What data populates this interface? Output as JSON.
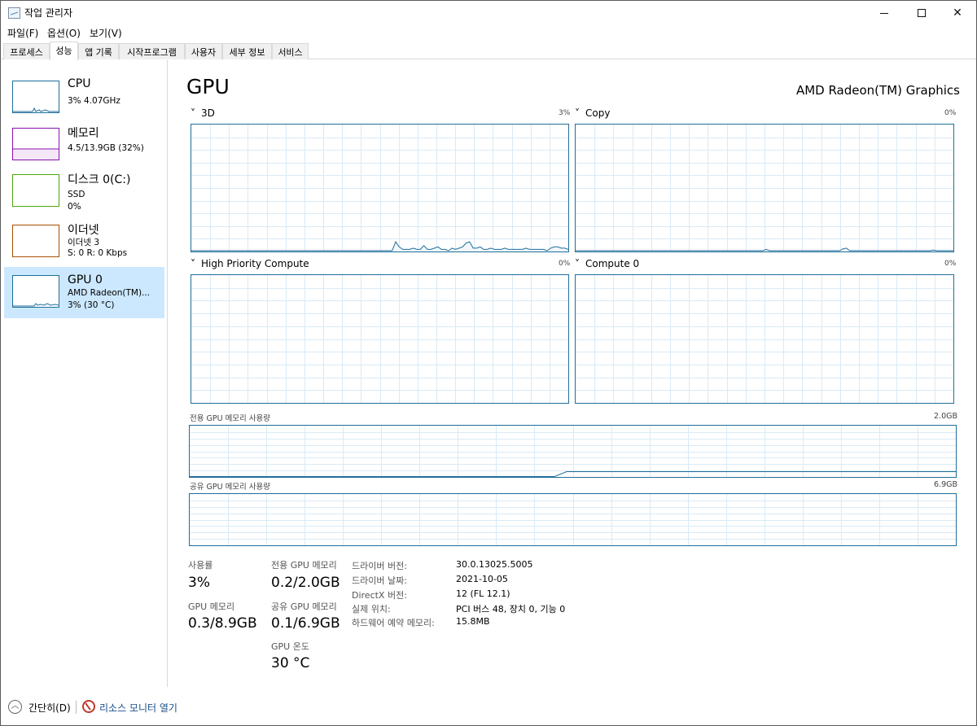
{
  "app": {
    "title": "작업 관리자"
  },
  "menu": {
    "file": "파일(F)",
    "options": "옵션(O)",
    "view": "보기(V)"
  },
  "tabs": [
    "프로세스",
    "성능",
    "앱 기록",
    "시작프로그램",
    "사용자",
    "세부 정보",
    "서비스"
  ],
  "active_tab": "성능",
  "colors": {
    "cpu": "#1f6e9a",
    "memory": "#8b12ae",
    "disk": "#4da60c",
    "ethernet": "#a74f01",
    "gpu": "#1f6e9a",
    "selected": "#cce8ff"
  },
  "sidebar": {
    "items": [
      {
        "title": "CPU",
        "line1": "3% 4.07GHz",
        "line2": ""
      },
      {
        "title": "메모리",
        "line1": "4.5/13.9GB (32%)",
        "line2": ""
      },
      {
        "title": "디스크 0(C:)",
        "line1": "SSD",
        "line2": "0%"
      },
      {
        "title": "이더넷",
        "line1": "이더넷 3",
        "line2": "S: 0  R: 0 Kbps"
      },
      {
        "title": "GPU 0",
        "line1": "AMD Radeon(TM)...",
        "line2": "3% (30 °C)"
      }
    ]
  },
  "main": {
    "title": "GPU",
    "device_name": "AMD Radeon(TM) Graphics",
    "engines": [
      {
        "label": "3D",
        "pct": "3%"
      },
      {
        "label": "Copy",
        "pct": "0%"
      },
      {
        "label": "High Priority Compute",
        "pct": "0%"
      },
      {
        "label": "Compute 0",
        "pct": "0%"
      }
    ],
    "dedicated_mem": {
      "label": "전용 GPU 메모리 사용량",
      "max": "2.0GB"
    },
    "shared_mem": {
      "label": "공유 GPU 메모리 사용량",
      "max": "6.9GB"
    },
    "stats": {
      "utilization_label": "사용률",
      "utilization": "3%",
      "gpu_mem_label": "GPU 메모리",
      "gpu_mem": "0.3/8.9GB",
      "dedicated_label": "전용 GPU 메모리",
      "dedicated": "0.2/2.0GB",
      "shared_label": "공유 GPU 메모리",
      "shared": "0.1/6.9GB",
      "temp_label": "GPU 온도",
      "temp": "30 °C"
    },
    "info": [
      {
        "key": "드라이버 버전:",
        "value": "30.0.13025.5005"
      },
      {
        "key": "드라이버 날짜:",
        "value": "2021-10-05"
      },
      {
        "key": "DirectX 버전:",
        "value": "12 (FL 12.1)"
      },
      {
        "key": "실제 위치:",
        "value": "PCI 버스 48, 장치 0, 기능 0"
      },
      {
        "key": "하드웨어 예약 메모리:",
        "value": "15.8MB"
      }
    ]
  },
  "footer": {
    "fewer_details": "간단히(D)",
    "resource_monitor": "리소스 모니터 열기"
  },
  "graph_series": {
    "3d": [
      0,
      0,
      0,
      0,
      0,
      0,
      0,
      0,
      0,
      0,
      0,
      0,
      0,
      0,
      0,
      0,
      0,
      0,
      0,
      0,
      0,
      0,
      0,
      0,
      0,
      0,
      0,
      0,
      0,
      0,
      0,
      0,
      0,
      0,
      0,
      0,
      0,
      0,
      0,
      0,
      0,
      0,
      0,
      0,
      0,
      0,
      0,
      0,
      0,
      0,
      0,
      0,
      0,
      0,
      0,
      0,
      0,
      0,
      7,
      3,
      1,
      1,
      1,
      2,
      1,
      1,
      4,
      1,
      1,
      2,
      3,
      1,
      1,
      0,
      2,
      1,
      2,
      3,
      6,
      7,
      2,
      2,
      3,
      1,
      1,
      2,
      1,
      1,
      1,
      2,
      1,
      1,
      1,
      1,
      1,
      2,
      1,
      1,
      1,
      1,
      1,
      0,
      2,
      3,
      3,
      2,
      2,
      1
    ],
    "copy": [
      0,
      0,
      0,
      0,
      0,
      0,
      0,
      0,
      0,
      0,
      0,
      0,
      0,
      0,
      0,
      0,
      0,
      0,
      0,
      0,
      0,
      0,
      0,
      0,
      0,
      0,
      0,
      0,
      0,
      0,
      0,
      0,
      0,
      0,
      0,
      0,
      0,
      0,
      0,
      0,
      0,
      0,
      0,
      0,
      0,
      0,
      0,
      0,
      0,
      0,
      0,
      0,
      0,
      0,
      0,
      0,
      0,
      1,
      0,
      0,
      0,
      0,
      0,
      0,
      0,
      0,
      0,
      0,
      0,
      0,
      0,
      0,
      0,
      0,
      0,
      0,
      0,
      0,
      0,
      0,
      1.5,
      2,
      0,
      0,
      0,
      0,
      0,
      0,
      0,
      0,
      0,
      0,
      0,
      0,
      0,
      0,
      0,
      0,
      0,
      0,
      0,
      0,
      0,
      0,
      0,
      0,
      0,
      0.5,
      0,
      0,
      0,
      0,
      0,
      0
    ]
  },
  "dedicated_mem_level": 0.1
}
